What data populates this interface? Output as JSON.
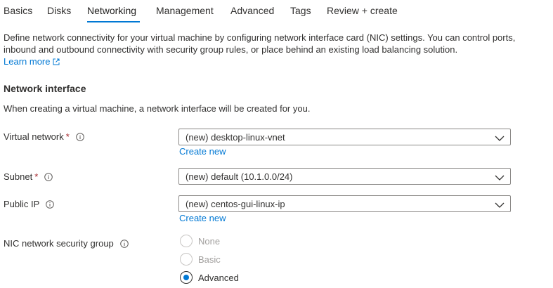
{
  "tabs": [
    {
      "label": "Basics"
    },
    {
      "label": "Disks"
    },
    {
      "label": "Networking"
    },
    {
      "label": "Management"
    },
    {
      "label": "Advanced"
    },
    {
      "label": "Tags"
    },
    {
      "label": "Review + create"
    }
  ],
  "active_tab": "Networking",
  "description": "Define network connectivity for your virtual machine by configuring network interface card (NIC) settings. You can control ports, inbound and outbound connectivity with security group rules, or place behind an existing load balancing solution.",
  "learn_more": "Learn more",
  "section": {
    "title": "Network interface",
    "description": "When creating a virtual machine, a network interface will be created for you."
  },
  "fields": {
    "virtual_network": {
      "label": "Virtual network",
      "required_mark": "*",
      "value": "(new) desktop-linux-vnet",
      "create_new": "Create new"
    },
    "subnet": {
      "label": "Subnet",
      "required_mark": "*",
      "value": "(new) default (10.1.0.0/24)"
    },
    "public_ip": {
      "label": "Public IP",
      "value": "(new) centos-gui-linux-ip",
      "create_new": "Create new"
    },
    "nic_nsg": {
      "label": "NIC network security group",
      "options": [
        "None",
        "Basic",
        "Advanced"
      ],
      "selected": "Advanced"
    }
  },
  "colors": {
    "accent": "#0078d4",
    "required": "#a4262c",
    "text": "#323130"
  }
}
